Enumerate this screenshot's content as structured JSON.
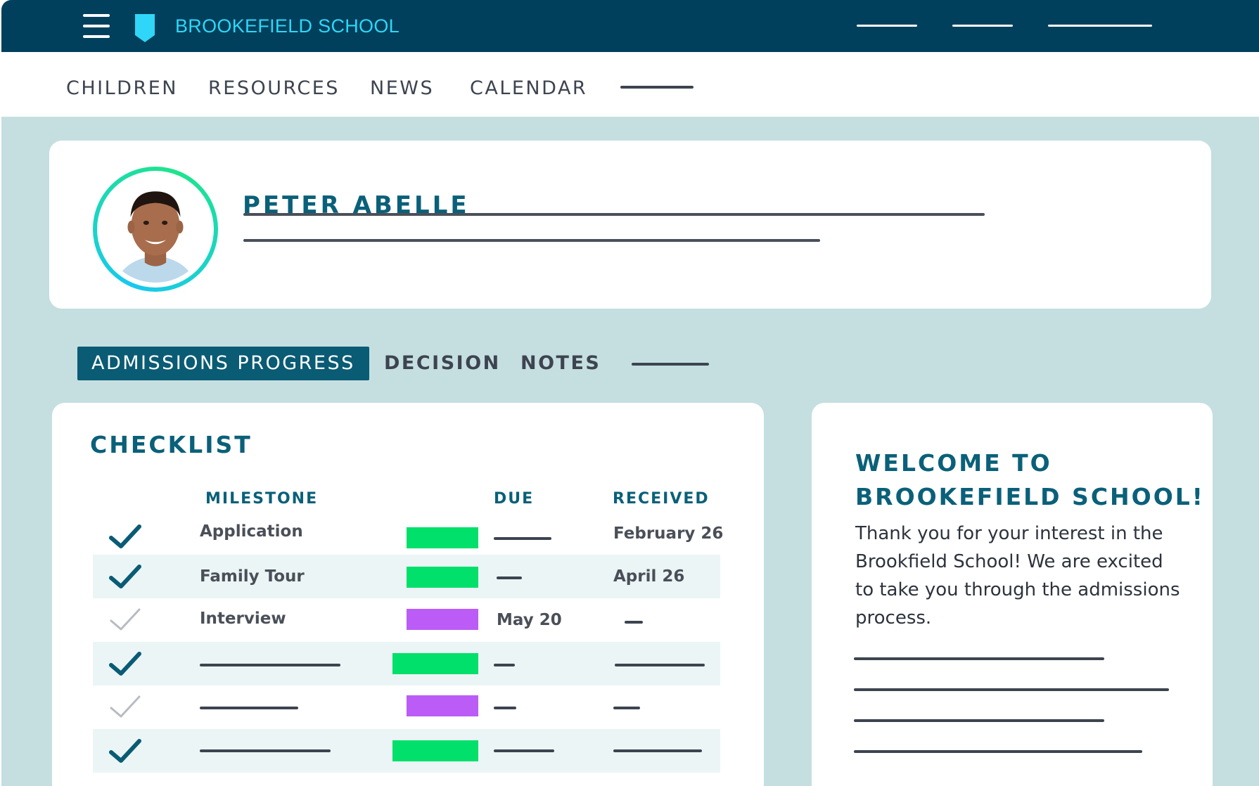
{
  "app": {
    "brand": "BROOKEFIELD SCHOOL"
  },
  "nav": {
    "items": [
      {
        "label": "CHILDREN"
      },
      {
        "label": "RESOURCES"
      },
      {
        "label": "NEWS"
      },
      {
        "label": "CALENDAR"
      }
    ]
  },
  "profile": {
    "name": "PETER ABELLE"
  },
  "tabs": [
    {
      "label": "ADMISSIONS PROGRESS",
      "active": true
    },
    {
      "label": "DECISION"
    },
    {
      "label": "NOTES"
    }
  ],
  "checklist": {
    "title": "CHECKLIST",
    "columns": {
      "milestone": "MILESTONE",
      "due": "DUE",
      "received": "RECEIVED"
    },
    "rows": [
      {
        "milestone": "Application",
        "due": "",
        "received": "February 26",
        "complete": true,
        "status_color": "#00e06a"
      },
      {
        "milestone": "Family Tour",
        "due": "",
        "received": "April 26",
        "complete": true,
        "status_color": "#00e06a"
      },
      {
        "milestone": "Interview",
        "due": "May 20",
        "received": "",
        "complete": false,
        "status_color": "#bb5cf6"
      },
      {
        "milestone": "",
        "due": "",
        "received": "",
        "complete": true,
        "status_color": "#00e06a"
      },
      {
        "milestone": "",
        "due": "",
        "received": "",
        "complete": false,
        "status_color": "#bb5cf6"
      },
      {
        "milestone": "",
        "due": "",
        "received": "",
        "complete": true,
        "status_color": "#00e06a"
      }
    ]
  },
  "welcome": {
    "title": "WELCOME TO BROOKEFIELD SCHOOL!",
    "body": "Thank you for your interest in the Brookfield School! We are excited to take you through the admissions process."
  },
  "colors": {
    "header_bg": "#00405c",
    "brand_accent": "#2fd6f7",
    "heading": "#0a6079",
    "complete": "#00e06a",
    "pending": "#bb5cf6",
    "page_bg": "#c5dfe0"
  },
  "icons": {
    "menu": "hamburger-icon",
    "logo": "shield-icon",
    "done": "checkmark-icon",
    "pending": "checkmark-outline-icon"
  }
}
